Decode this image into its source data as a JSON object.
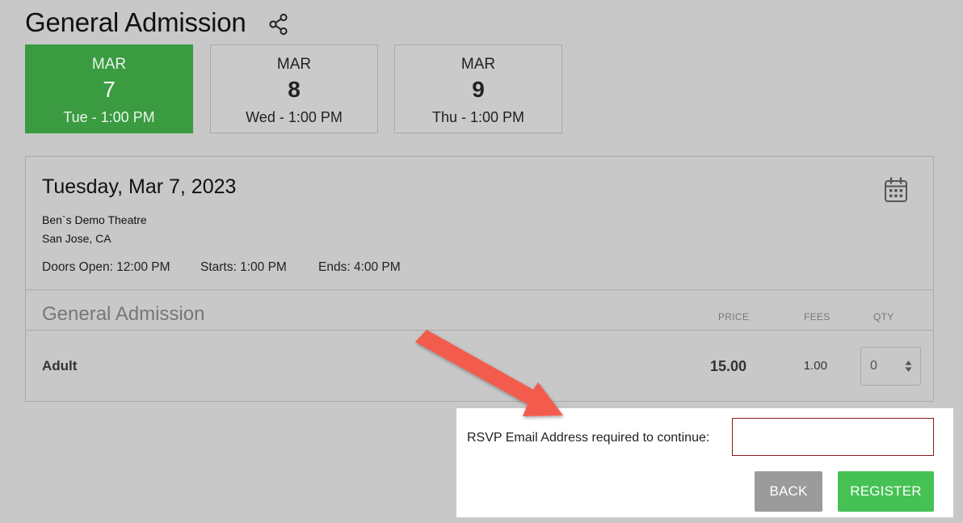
{
  "page": {
    "title": "General Admission"
  },
  "dates": [
    {
      "month": "MAR",
      "day": "7",
      "dow": "Tue - 1:00 PM",
      "active": true
    },
    {
      "month": "MAR",
      "day": "8",
      "dow": "Wed - 1:00 PM",
      "active": false
    },
    {
      "month": "MAR",
      "day": "9",
      "dow": "Thu - 1:00 PM",
      "active": false
    }
  ],
  "event": {
    "date_long": "Tuesday, Mar 7, 2023",
    "venue": "Ben`s Demo Theatre",
    "city": "San Jose, CA",
    "doors_open": "Doors Open: 12:00 PM",
    "starts": "Starts: 1:00 PM",
    "ends": "Ends: 4:00 PM"
  },
  "tickets": {
    "section_title": "General Admission",
    "headers": {
      "price": "PRICE",
      "fees": "FEES",
      "qty": "QTY"
    },
    "rows": [
      {
        "name": "Adult",
        "price": "15.00",
        "fees": "1.00",
        "qty": "0"
      }
    ]
  },
  "rsvp": {
    "label": "RSVP Email Address required to continue:",
    "email_value": "",
    "back_label": "BACK",
    "register_label": "REGISTER"
  },
  "colors": {
    "active_date": "#3a9b41",
    "register_button": "#46c255",
    "back_button": "#9b9b9b",
    "input_border_error": "#8b1a1a",
    "annotation_arrow": "#f35b4e"
  }
}
